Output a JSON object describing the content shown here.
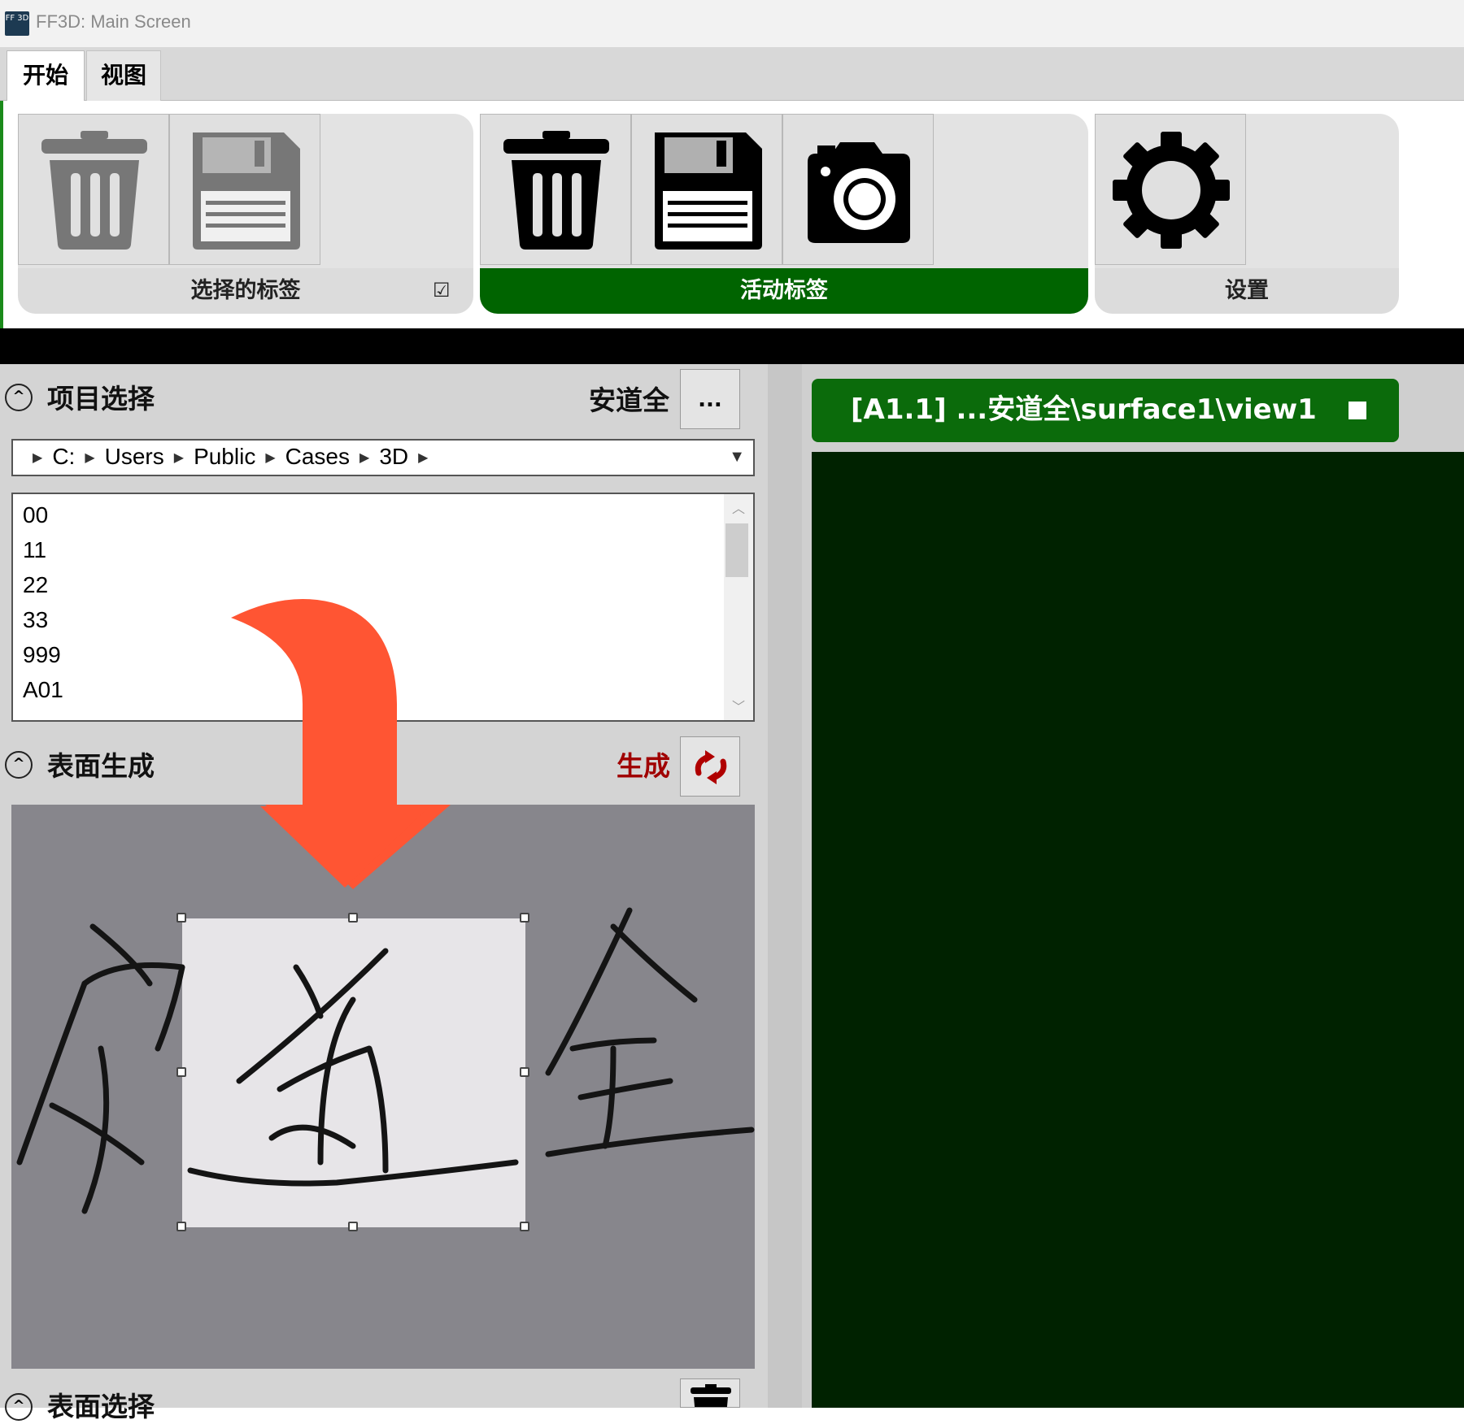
{
  "window": {
    "title": "FF3D: Main Screen",
    "icon": "app-logo-icon",
    "icon_text": "FF 3D"
  },
  "tabs": [
    {
      "label": "开始"
    },
    {
      "label": "视图"
    }
  ],
  "ribbon": {
    "groups": [
      {
        "label": "选择的标签",
        "tools": [
          "trash-icon",
          "floppy-disk-icon"
        ],
        "state": "disabled",
        "checkbox": "☑"
      },
      {
        "label": "活动标签",
        "tools": [
          "trash-icon",
          "floppy-disk-icon",
          "camera-icon"
        ],
        "state": "active"
      },
      {
        "label": "设置",
        "tools": [
          "gear-icon"
        ]
      }
    ]
  },
  "left_panel": {
    "project_selection": {
      "title": "项目选择",
      "current_project": "安道全",
      "browse_label": "...",
      "breadcrumb": [
        "C:",
        "Users",
        "Public",
        "Cases",
        "3D"
      ],
      "items": [
        "00",
        "11",
        "22",
        "33",
        "999",
        "A01"
      ]
    },
    "surface_generation": {
      "title": "表面生成",
      "generate_label": "生成",
      "generate_icon": "refresh-arrows-icon"
    },
    "surface_selection": {
      "title": "表面选择",
      "delete_icon": "trash-icon"
    }
  },
  "right_panel": {
    "view_tab_label": "[A1.1] ...安道全\\surface1\\view1"
  },
  "colors": {
    "active_green": "#006400",
    "view_tab_green": "#0b6b0b",
    "canvas_bg": "#002200",
    "overlay_arrow": "#ff5533",
    "generate_red": "#a00000"
  }
}
